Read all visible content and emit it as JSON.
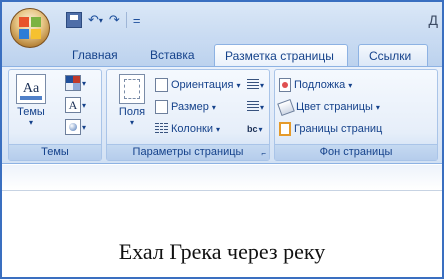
{
  "window": {
    "title_partial": "Д"
  },
  "quick_access": {
    "undo_glyph": "↶",
    "redo_glyph": "↷",
    "dropdown_glyph": "▾",
    "customize_glyph": "="
  },
  "tabs": [
    {
      "label": "Главная",
      "active": false
    },
    {
      "label": "Вставка",
      "active": false
    },
    {
      "label": "Разметка страницы",
      "active": true
    },
    {
      "label": "Ссылки",
      "active": false
    }
  ],
  "ribbon": {
    "themes": {
      "label": "Темы",
      "big_button": "Темы",
      "big_icon_text": "Aa",
      "fonts_icon_text": "A",
      "theme_colors": [
        "#1f4e9a",
        "#c0392b",
        "#e8eef8",
        "#8ea8d8"
      ]
    },
    "page_setup": {
      "label": "Параметры страницы",
      "fields": "Поля",
      "orientation": "Ориентация",
      "size": "Размер",
      "columns": "Колонки",
      "hyphenation_icon": "bc",
      "launcher_glyph": "⌐"
    },
    "page_background": {
      "label": "Фон страницы",
      "watermark": "Подложка",
      "page_color": "Цвет страницы",
      "page_borders": "Границы страниц"
    }
  },
  "document": {
    "text": "Ехал Грека через реку"
  },
  "colors": {
    "accent": "#15428b",
    "frame": "#3a6fc0"
  }
}
